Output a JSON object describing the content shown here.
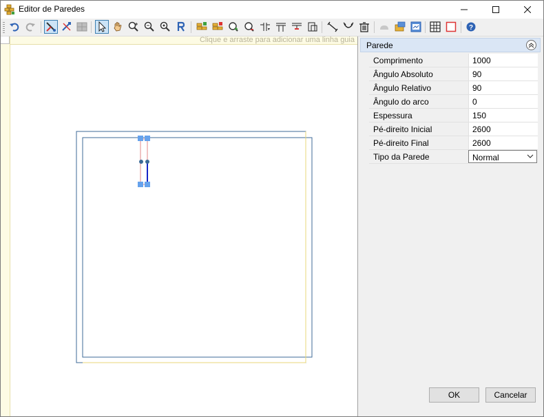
{
  "window": {
    "title": "Editor de Paredes",
    "minimize_icon": "minimize-icon",
    "maximize_icon": "maximize-icon",
    "close_icon": "close-icon"
  },
  "toolbar": {
    "items": [
      "undo-icon",
      "redo-icon",
      "draw-wall-icon",
      "wall-options-icon",
      "grid-icon",
      "select-pointer-icon",
      "pan-hand-icon",
      "zoom-in-icon",
      "zoom-out-icon",
      "zoom-fit-icon",
      "rotate-icon",
      "add-window-icon",
      "add-door-icon",
      "add-opening-icon",
      "remove-opening-icon",
      "dimension-h-icon",
      "dimension-top-icon",
      "dimension-bottom-icon",
      "dimension-frame-icon",
      "measure-icon",
      "arc-icon",
      "trash-icon",
      "disabled-icon",
      "folder-icon",
      "image-icon",
      "table-icon",
      "square-icon",
      "help-icon"
    ]
  },
  "canvas": {
    "guide_hint": "Clique e arraste para adicionar uma linha guia"
  },
  "properties": {
    "section_label": "Parede",
    "rows": [
      {
        "name": "Comprimento",
        "value": "1000"
      },
      {
        "name": "Ângulo Absoluto",
        "value": "90"
      },
      {
        "name": "Ângulo Relativo",
        "value": "90"
      },
      {
        "name": "Ângulo do arco",
        "value": "0"
      },
      {
        "name": "Espessura",
        "value": "150"
      },
      {
        "name": "Pé-direito Inicial",
        "value": "2600"
      },
      {
        "name": "Pé-direito Final",
        "value": "2600"
      },
      {
        "name": "Tipo da Parede",
        "value": "Normal"
      }
    ]
  },
  "buttons": {
    "ok": "OK",
    "cancel": "Cancelar"
  },
  "colors": {
    "accent": "#0a64d8",
    "wall_outline": "#3c6a97",
    "guide_yellow": "#e8d77a",
    "selected_wall": "#e08a8a",
    "handle": "#66a2ec"
  }
}
